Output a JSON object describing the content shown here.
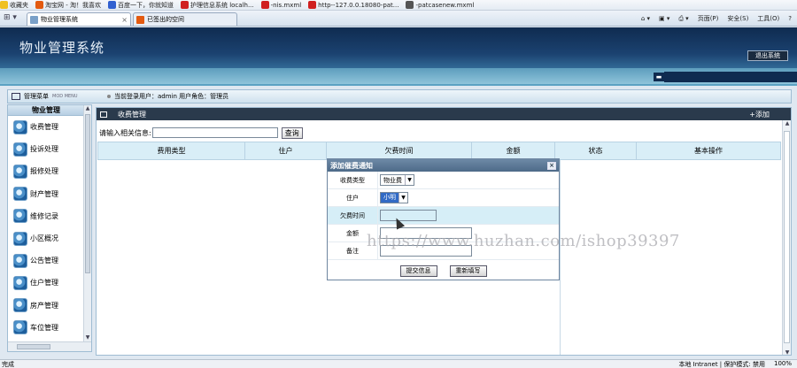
{
  "browser": {
    "favorites": [
      {
        "label": "收藏夹",
        "color": "#f0c020"
      },
      {
        "label": "淘宝网 - 淘！我喜欢",
        "color": "#e35a10"
      },
      {
        "label": "百度一下，你就知道",
        "color": "#3060d0"
      },
      {
        "label": "护理信息系统 localh...",
        "color": "#d02020"
      },
      {
        "label": "-nis.mxml",
        "color": "#d02020"
      },
      {
        "label": "http--127.0.0.18080-pat...",
        "color": "#d02020"
      },
      {
        "label": "-patcasenew.mxml",
        "color": "#555555"
      }
    ],
    "tabs": [
      {
        "label": "物业管理系统",
        "active": true
      },
      {
        "label": "已签出的空间",
        "active": false
      }
    ],
    "tools": [
      "页面(P)",
      "安全(S)",
      "工具(O)"
    ],
    "status_left": "完成",
    "status_zone": "本地 Intranet | 保护模式: 禁用",
    "zoom": "100%"
  },
  "app": {
    "title": "物业管理系统",
    "logout_label": "退出系统",
    "mini_icon": "▬"
  },
  "infobar": {
    "menu_title": "管理菜单",
    "menu_sub": "MOD MENU",
    "user_text": "当前登录用户：admin  用户角色：管理员"
  },
  "sidebar": {
    "category": "物业管理",
    "items": [
      "收费管理",
      "投诉处理",
      "报修处理",
      "财产管理",
      "维修记录",
      "小区概况",
      "公告管理",
      "住户管理",
      "房产管理",
      "车位管理"
    ]
  },
  "main": {
    "header_title": "收费管理",
    "add_label": "+添加",
    "search_label": "请输入相关信息:",
    "search_value": "",
    "search_button": "查询",
    "columns": [
      "费用类型",
      "住户",
      "欠费时间",
      "金额",
      "状态",
      "基本操作"
    ]
  },
  "dialog": {
    "title": "添加催费通知",
    "close": "×",
    "fields": [
      {
        "label": "收费类型",
        "value": "物业费"
      },
      {
        "label": "住户",
        "value": "小明"
      },
      {
        "label": "欠费时间",
        "value": ""
      },
      {
        "label": "金额",
        "value": ""
      },
      {
        "label": "备注",
        "value": ""
      }
    ],
    "submit_label": "提交信息",
    "reset_label": "重新填写"
  },
  "watermark": "https://www.huzhan.com/ishop39397"
}
